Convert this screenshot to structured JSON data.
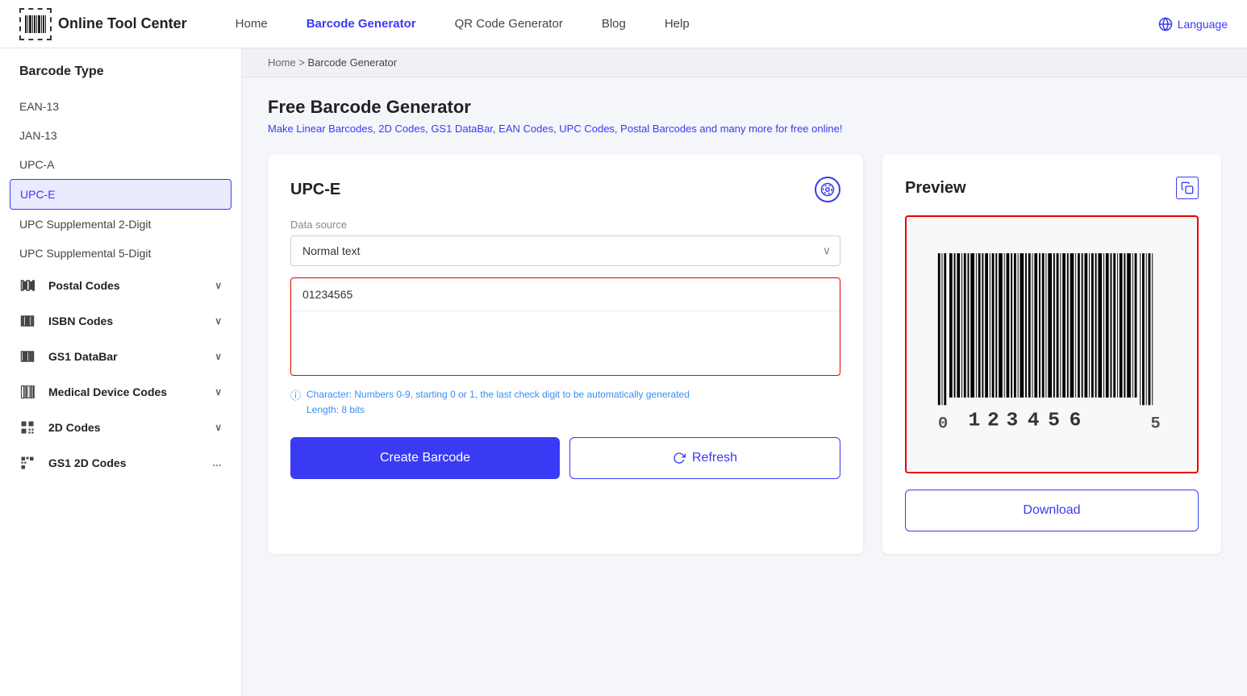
{
  "header": {
    "logo_text": "Online Tool Center",
    "nav": [
      {
        "label": "Home",
        "active": false
      },
      {
        "label": "Barcode Generator",
        "active": true
      },
      {
        "label": "QR Code Generator",
        "active": false
      },
      {
        "label": "Blog",
        "active": false
      },
      {
        "label": "Help",
        "active": false
      }
    ],
    "language_label": "Language"
  },
  "sidebar": {
    "title": "Barcode Type",
    "items": [
      {
        "label": "EAN-13",
        "active": false,
        "group": false
      },
      {
        "label": "JAN-13",
        "active": false,
        "group": false
      },
      {
        "label": "UPC-A",
        "active": false,
        "group": false
      },
      {
        "label": "UPC-E",
        "active": true,
        "group": false
      },
      {
        "label": "UPC Supplemental 2-Digit",
        "active": false,
        "group": false
      },
      {
        "label": "UPC Supplemental 5-Digit",
        "active": false,
        "group": false
      },
      {
        "label": "Postal Codes",
        "active": false,
        "group": true
      },
      {
        "label": "ISBN Codes",
        "active": false,
        "group": true
      },
      {
        "label": "GS1 DataBar",
        "active": false,
        "group": true
      },
      {
        "label": "Medical Device Codes",
        "active": false,
        "group": true
      },
      {
        "label": "2D Codes",
        "active": false,
        "group": true
      },
      {
        "label": "GS1 2D Codes",
        "active": false,
        "group": true
      }
    ]
  },
  "breadcrumb": {
    "home": "Home",
    "separator": ">",
    "current": "Barcode Generator"
  },
  "main": {
    "page_title": "Free Barcode Generator",
    "page_subtitle": "Make Linear Barcodes, 2D Codes, GS1 DataBar, EAN Codes, UPC Codes, Postal Barcodes and many more for free online!",
    "tool_title": "UPC-E",
    "data_source_label": "Data source",
    "data_source_value": "Normal text",
    "data_input_value": "01234565",
    "hint_line1": "Character: Numbers 0-9, starting 0 or 1, the last check digit to be automatically generated",
    "hint_line2": "Length: 8 bits",
    "btn_create": "Create Barcode",
    "btn_refresh": "Refresh",
    "preview_title": "Preview",
    "btn_download": "Download",
    "barcode_digits": "0  123456  5"
  }
}
